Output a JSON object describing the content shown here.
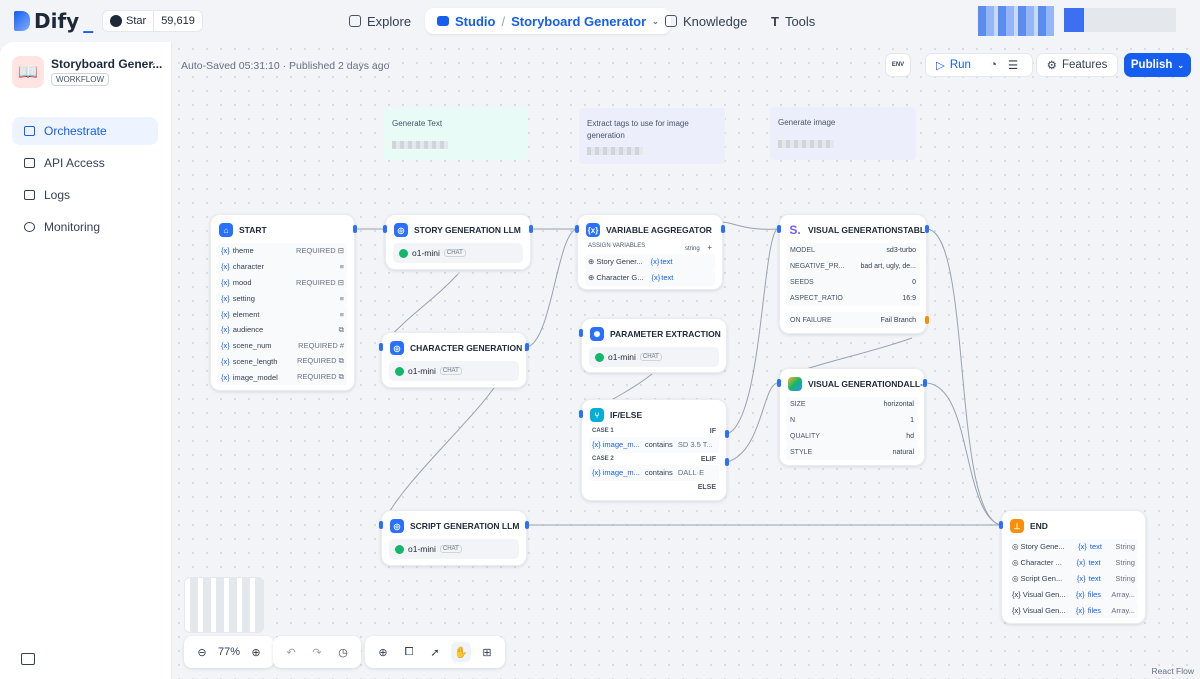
{
  "brand": {
    "logo": "Dify",
    "star_label": "Star",
    "star_count": "59,619"
  },
  "nav": {
    "explore": "Explore",
    "studio": "Studio",
    "app_breadcrumb": "Storyboard Generator",
    "knowledge": "Knowledge",
    "tools": "Tools"
  },
  "sidebar": {
    "app_name": "Storyboard Gener...",
    "app_type": "WORKFLOW",
    "items": [
      {
        "label": "Orchestrate"
      },
      {
        "label": "API Access"
      },
      {
        "label": "Logs"
      },
      {
        "label": "Monitoring"
      }
    ]
  },
  "status": {
    "saved": "Auto-Saved 05:31:10",
    "published": "Published 2 days ago"
  },
  "toolbar": {
    "env": "ENV",
    "run": "Run",
    "features": "Features",
    "publish": "Publish"
  },
  "notes": [
    {
      "text": "Generate Text"
    },
    {
      "text": "Extract tags to use for image generation"
    },
    {
      "text": "Generate image"
    }
  ],
  "nodes": {
    "start": {
      "title": "START",
      "vars": [
        {
          "name": "theme",
          "req": "REQUIRED ⊟"
        },
        {
          "name": "character",
          "req": "≡"
        },
        {
          "name": "mood",
          "req": "REQUIRED ⊟"
        },
        {
          "name": "setting",
          "req": "≡"
        },
        {
          "name": "element",
          "req": "≡"
        },
        {
          "name": "audience",
          "req": "⧉"
        },
        {
          "name": "scene_num",
          "req": "REQUIRED #"
        },
        {
          "name": "scene_length",
          "req": "REQUIRED ⧉"
        },
        {
          "name": "image_model",
          "req": "REQUIRED ⧉"
        }
      ]
    },
    "story": {
      "title": "STORY GENERATION LLM",
      "model": "o1-mini",
      "mode": "CHAT"
    },
    "character": {
      "title": "CHARACTER GENERATION L",
      "model": "o1-mini",
      "mode": "CHAT"
    },
    "script": {
      "title": "SCRIPT GENERATION LLM",
      "model": "o1-mini",
      "mode": "CHAT"
    },
    "aggregator": {
      "title": "VARIABLE AGGREGATOR",
      "assign_label": "ASSIGN VARIABLES",
      "type": "string",
      "plus": "+",
      "rows": [
        {
          "src": "Story Gener...",
          "var": "text"
        },
        {
          "src": "Character G...",
          "var": "text"
        }
      ]
    },
    "param": {
      "title": "PARAMETER EXTRACTION",
      "model": "o1-mini",
      "mode": "CHAT"
    },
    "ifelse": {
      "title": "IF/ELSE",
      "case1": "CASE 1",
      "if": "IF",
      "cond1_var": "image_m...",
      "cond1_op": "contains",
      "cond1_val": "SD 3.5 T...",
      "case2": "CASE 2",
      "elif": "ELIF",
      "cond2_var": "image_m...",
      "cond2_op": "contains",
      "cond2_val": "DALL·E",
      "else": "ELSE"
    },
    "sd": {
      "title": "VISUAL GENERATIONSTABL",
      "rows": [
        {
          "k": "MODEL",
          "v": "sd3-turbo"
        },
        {
          "k": "NEGATIVE_PR...",
          "v": "bad art, ugly, de..."
        },
        {
          "k": "SEEDS",
          "v": "0"
        },
        {
          "k": "ASPECT_RATIO",
          "v": "16:9"
        }
      ],
      "failure_label": "ON FAILURE",
      "failure_value": "Fail Branch"
    },
    "dalle": {
      "title": "VISUAL GENERATIONDALL-E",
      "rows": [
        {
          "k": "SIZE",
          "v": "horizontal"
        },
        {
          "k": "N",
          "v": "1"
        },
        {
          "k": "QUALITY",
          "v": "hd"
        },
        {
          "k": "STYLE",
          "v": "natural"
        }
      ]
    },
    "end": {
      "title": "END",
      "rows": [
        {
          "src": "Story Gene...",
          "var": "text",
          "type": "String"
        },
        {
          "src": "Character ...",
          "var": "text",
          "type": "String"
        },
        {
          "src": "Script Gen...",
          "var": "text",
          "type": "String"
        },
        {
          "src": "Visual Gen...",
          "var": "files",
          "type": "Array..."
        },
        {
          "src": "Visual Gen...",
          "var": "files",
          "type": "Array..."
        }
      ]
    }
  },
  "zoom": "77%",
  "footer": {
    "reactflow": "React Flow"
  },
  "colors": {
    "accent": "#155eef",
    "canvas": "#f2f4f7",
    "note_green": "#ecfdf9",
    "note_purple": "#eef0fc"
  }
}
